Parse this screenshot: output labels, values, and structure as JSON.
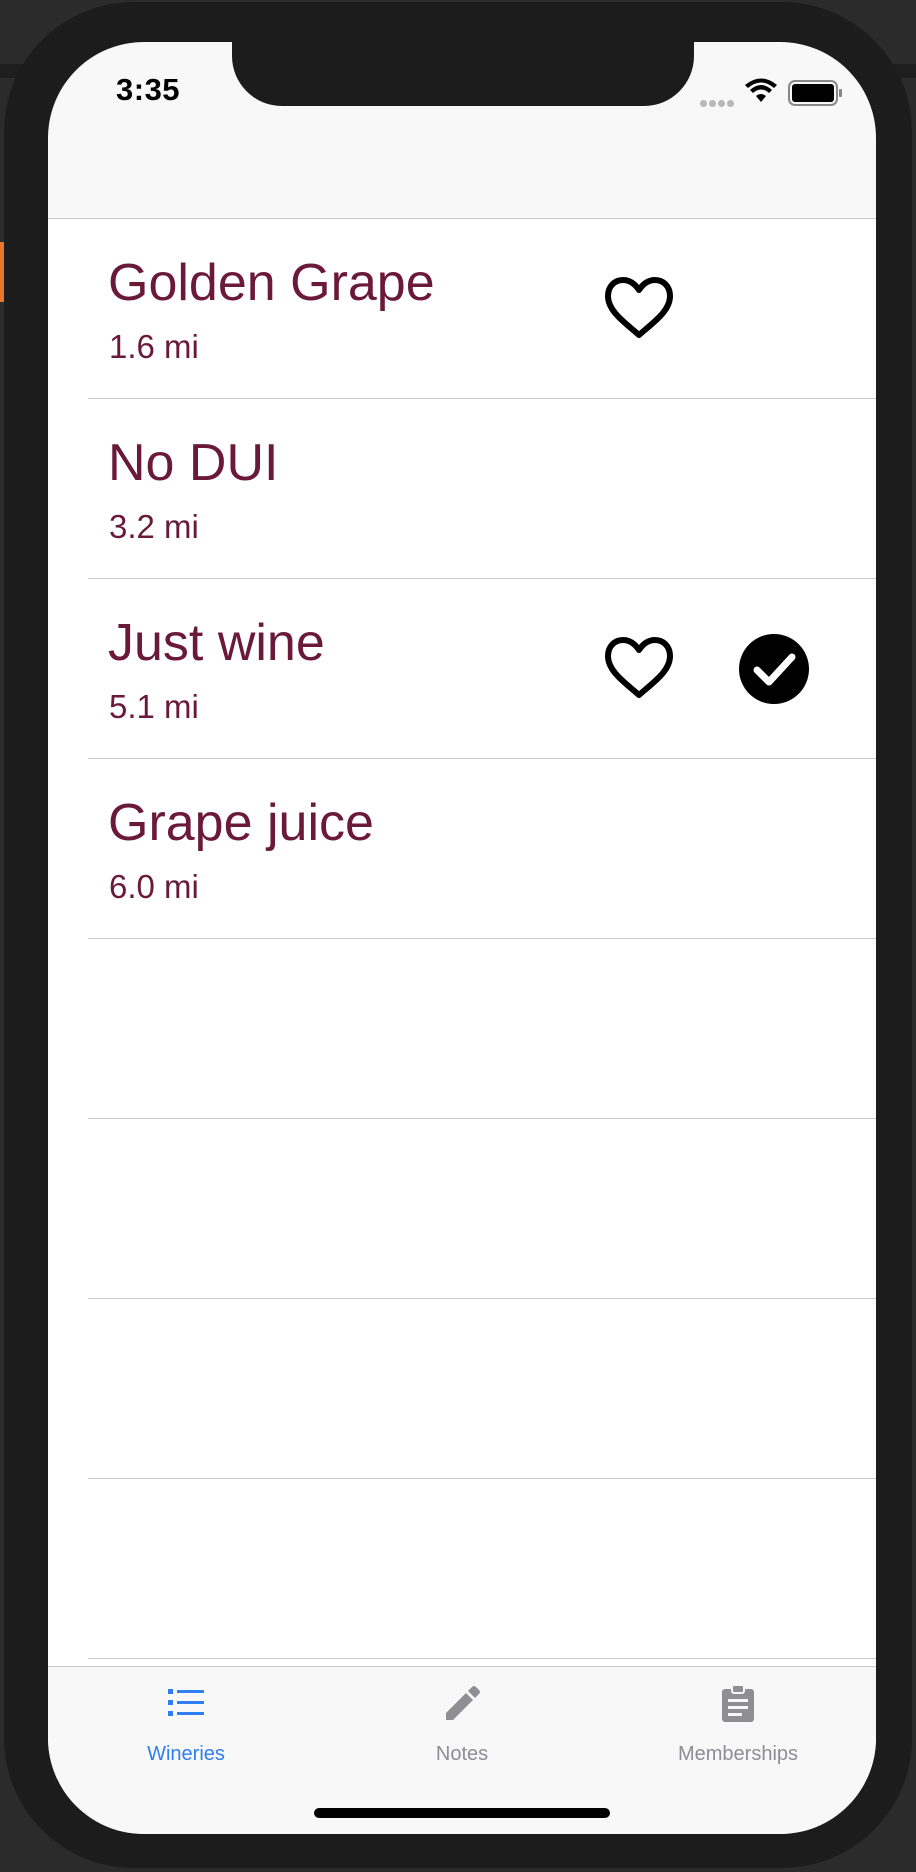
{
  "status_bar": {
    "time": "3:35"
  },
  "wineries": [
    {
      "name": "Golden Grape",
      "distance": "1.6 mi",
      "favorite": true,
      "visited": false
    },
    {
      "name": "No DUI",
      "distance": "3.2 mi",
      "favorite": false,
      "visited": false
    },
    {
      "name": "Just wine",
      "distance": "5.1 mi",
      "favorite": true,
      "visited": true
    },
    {
      "name": "Grape juice",
      "distance": "6.0 mi",
      "favorite": false,
      "visited": false
    }
  ],
  "tabs": [
    {
      "label": "Wineries",
      "icon": "list-icon",
      "active": true
    },
    {
      "label": "Notes",
      "icon": "pencil-icon",
      "active": false
    },
    {
      "label": "Memberships",
      "icon": "clipboard-icon",
      "active": false
    }
  ],
  "colors": {
    "text": "#6a1a38",
    "tab_active": "#2f7ef2",
    "tab_inactive": "#8e8e93"
  }
}
